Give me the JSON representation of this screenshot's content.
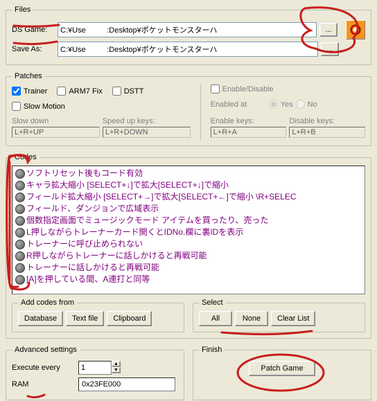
{
  "files": {
    "legend": "Files",
    "ds_game_label": "DS Game:",
    "ds_game_value": "C:¥Use          :Desktop¥ポケットモンスターハ",
    "save_as_label": "Save As:",
    "save_as_value": "C:¥Use          :Desktop¥ポケットモンスターハ",
    "browse_label": "..."
  },
  "patches": {
    "legend": "Patches",
    "trainer_label": "Trainer",
    "arm7_label": "ARM7 Fix",
    "dstt_label": "DSTT",
    "enable_disable_label": "Enable/Disable",
    "slowmotion_label": "Slow Motion",
    "slowdown_label": "Slow down",
    "speedup_label": "Speed up keys:",
    "slowdown_value": "L+R+UP",
    "speedup_value": "L+R+DOWN",
    "enabled_at_label": "Enabled at",
    "enable_keys_label": "Enable keys:",
    "disable_keys_label": "Disable keys:",
    "enable_keys_value": "L+R+A",
    "disable_keys_value": "L+R+B",
    "yes_label": "Yes",
    "no_label": "No"
  },
  "codes": {
    "legend": "Codes",
    "items": [
      "ソフトリセット後もコード有効",
      "キャラ拡大縮小 [SELECT+↓]で拡大[SELECT+↓]で縮小",
      "フィールド拡大縮小 [SELECT+→]で拡大[SELECT+←]で縮小 \\R+SELEC",
      "フィールド、ダンジョンで広域表示",
      "個数指定画面でミュージックモード アイテムを買ったり、売った",
      "L押しながらトレーナーカード開くとIDNo.欄に裏IDを表示",
      "トレーナーに呼び止められない",
      "R押しながらトレーナーに話しかけると再戦可能",
      "トレーナーに話しかけると再戦可能",
      "[A]を押している間、A連打と同等"
    ],
    "add_legend": "Add codes from",
    "add_buttons": {
      "db": "Database",
      "txt": "Text file",
      "clip": "Clipboard"
    },
    "select_legend": "Select",
    "select_buttons": {
      "all": "All",
      "none": "None",
      "clear": "Clear List"
    }
  },
  "advanced": {
    "legend": "Advanced settings",
    "execute_label": "Execute every",
    "execute_value": "1",
    "ram_label": "RAM",
    "ram_value": "0x23FE000"
  },
  "finish": {
    "legend": "Finish",
    "patch_label": "Patch Game"
  }
}
